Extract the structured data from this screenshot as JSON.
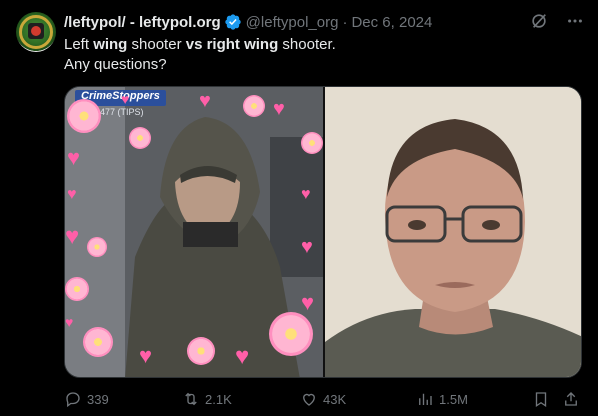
{
  "author": {
    "display_name": "/leftypol/ - leftypol.org",
    "handle": "@leftypol_org",
    "separator": "·",
    "date": "Dec 6, 2024",
    "verified_color": "#1d9bf0"
  },
  "tweet": {
    "text_line1_part1": "Left ",
    "text_line1_bold1": "wing",
    "text_line1_part2": " shooter ",
    "text_line1_bold2": "vs",
    "text_line1_part3": " ",
    "text_line1_bold3": "right wing",
    "text_line1_part4": " shooter.",
    "text_line2": "Any questions?"
  },
  "media": {
    "left_banner": "CrimeStoppers",
    "left_banner_sub": "100-8477 (TIPS)"
  },
  "actions": {
    "replies": "339",
    "reposts": "2.1K",
    "likes": "43K",
    "views": "1.5M"
  },
  "icons": [
    "grok-icon",
    "more-icon",
    "reply-icon",
    "repost-icon",
    "like-icon",
    "views-icon",
    "bookmark-icon",
    "share-icon"
  ],
  "colors": {
    "background": "#000000",
    "text": "#e7e9ea",
    "muted": "#71767b",
    "accent_hearts": "#ff5fa8"
  }
}
